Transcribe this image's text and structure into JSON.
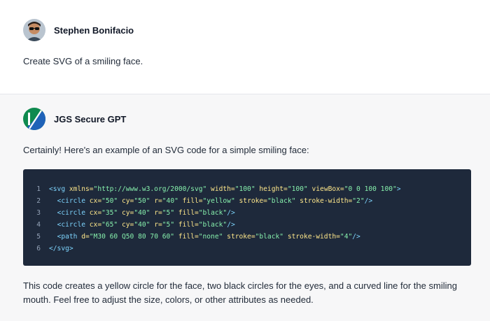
{
  "user": {
    "name": "Stephen Bonifacio",
    "message": "Create SVG of a smiling face."
  },
  "assistant": {
    "name": "JGS Secure GPT",
    "intro": "Certainly! Here's an example of an SVG code for a simple smiling face:",
    "outro": "This code creates a yellow circle for the face, two black circles for the eyes, and a curved line for the smiling mouth. Feel free to adjust the size, colors, or other attributes as needed.",
    "logo_colors": {
      "green": "#0f8a4f",
      "blue": "#1f62b8"
    }
  },
  "code": {
    "lines": [
      {
        "n": "1",
        "indent": "",
        "tokens": [
          {
            "t": "tag",
            "v": "<svg"
          },
          {
            "t": "attr",
            "v": " xmlns="
          },
          {
            "t": "str",
            "v": "\"http://www.w3.org/2000/svg\""
          },
          {
            "t": "attr",
            "v": " width="
          },
          {
            "t": "str",
            "v": "\"100\""
          },
          {
            "t": "attr",
            "v": " height="
          },
          {
            "t": "str",
            "v": "\"100\""
          },
          {
            "t": "attr",
            "v": " viewBox="
          },
          {
            "t": "str",
            "v": "\"0 0 100 100\""
          },
          {
            "t": "tag",
            "v": ">"
          }
        ]
      },
      {
        "n": "2",
        "indent": "  ",
        "tokens": [
          {
            "t": "tag",
            "v": "<circle"
          },
          {
            "t": "attr",
            "v": " cx="
          },
          {
            "t": "str",
            "v": "\"50\""
          },
          {
            "t": "attr",
            "v": " cy="
          },
          {
            "t": "str",
            "v": "\"50\""
          },
          {
            "t": "attr",
            "v": " r="
          },
          {
            "t": "str",
            "v": "\"40\""
          },
          {
            "t": "attr",
            "v": " fill="
          },
          {
            "t": "str",
            "v": "\"yellow\""
          },
          {
            "t": "attr",
            "v": " stroke="
          },
          {
            "t": "str",
            "v": "\"black\""
          },
          {
            "t": "attr",
            "v": " stroke-width="
          },
          {
            "t": "str",
            "v": "\"2\""
          },
          {
            "t": "tag",
            "v": "/>"
          }
        ]
      },
      {
        "n": "3",
        "indent": "  ",
        "tokens": [
          {
            "t": "tag",
            "v": "<circle"
          },
          {
            "t": "attr",
            "v": " cx="
          },
          {
            "t": "str",
            "v": "\"35\""
          },
          {
            "t": "attr",
            "v": " cy="
          },
          {
            "t": "str",
            "v": "\"40\""
          },
          {
            "t": "attr",
            "v": " r="
          },
          {
            "t": "str",
            "v": "\"5\""
          },
          {
            "t": "attr",
            "v": " fill="
          },
          {
            "t": "str",
            "v": "\"black\""
          },
          {
            "t": "tag",
            "v": "/>"
          }
        ]
      },
      {
        "n": "4",
        "indent": "  ",
        "tokens": [
          {
            "t": "tag",
            "v": "<circle"
          },
          {
            "t": "attr",
            "v": " cx="
          },
          {
            "t": "str",
            "v": "\"65\""
          },
          {
            "t": "attr",
            "v": " cy="
          },
          {
            "t": "str",
            "v": "\"40\""
          },
          {
            "t": "attr",
            "v": " r="
          },
          {
            "t": "str",
            "v": "\"5\""
          },
          {
            "t": "attr",
            "v": " fill="
          },
          {
            "t": "str",
            "v": "\"black\""
          },
          {
            "t": "tag",
            "v": "/>"
          }
        ]
      },
      {
        "n": "5",
        "indent": "  ",
        "tokens": [
          {
            "t": "tag",
            "v": "<path"
          },
          {
            "t": "attr",
            "v": " d="
          },
          {
            "t": "str",
            "v": "\"M30 60 Q50 80 70 60\""
          },
          {
            "t": "attr",
            "v": " fill="
          },
          {
            "t": "str",
            "v": "\"none\""
          },
          {
            "t": "attr",
            "v": " stroke="
          },
          {
            "t": "str",
            "v": "\"black\""
          },
          {
            "t": "attr",
            "v": " stroke-width="
          },
          {
            "t": "str",
            "v": "\"4\""
          },
          {
            "t": "tag",
            "v": "/>"
          }
        ]
      },
      {
        "n": "6",
        "indent": "",
        "tokens": [
          {
            "t": "tag",
            "v": "</svg>"
          }
        ]
      }
    ]
  }
}
